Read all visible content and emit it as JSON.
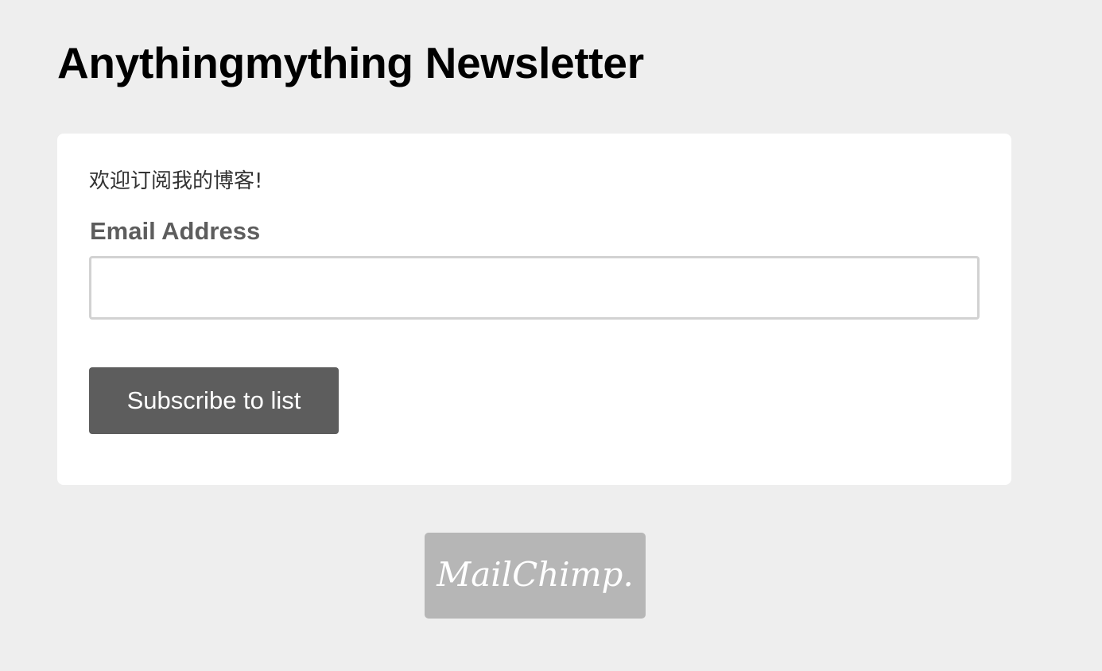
{
  "page": {
    "title": "Anythingmything Newsletter"
  },
  "form": {
    "intro": "欢迎订阅我的博客!",
    "email_label": "Email Address",
    "email_value": "",
    "email_placeholder": "",
    "submit_label": "Subscribe to list"
  },
  "footer": {
    "badge_text": "MailChimp.",
    "badge_icon": "mailchimp-logo"
  },
  "colors": {
    "background": "#eeeeee",
    "card": "#ffffff",
    "button": "#5d5d5d",
    "label": "#5d5d5d",
    "badge": "#b6b6b6"
  }
}
